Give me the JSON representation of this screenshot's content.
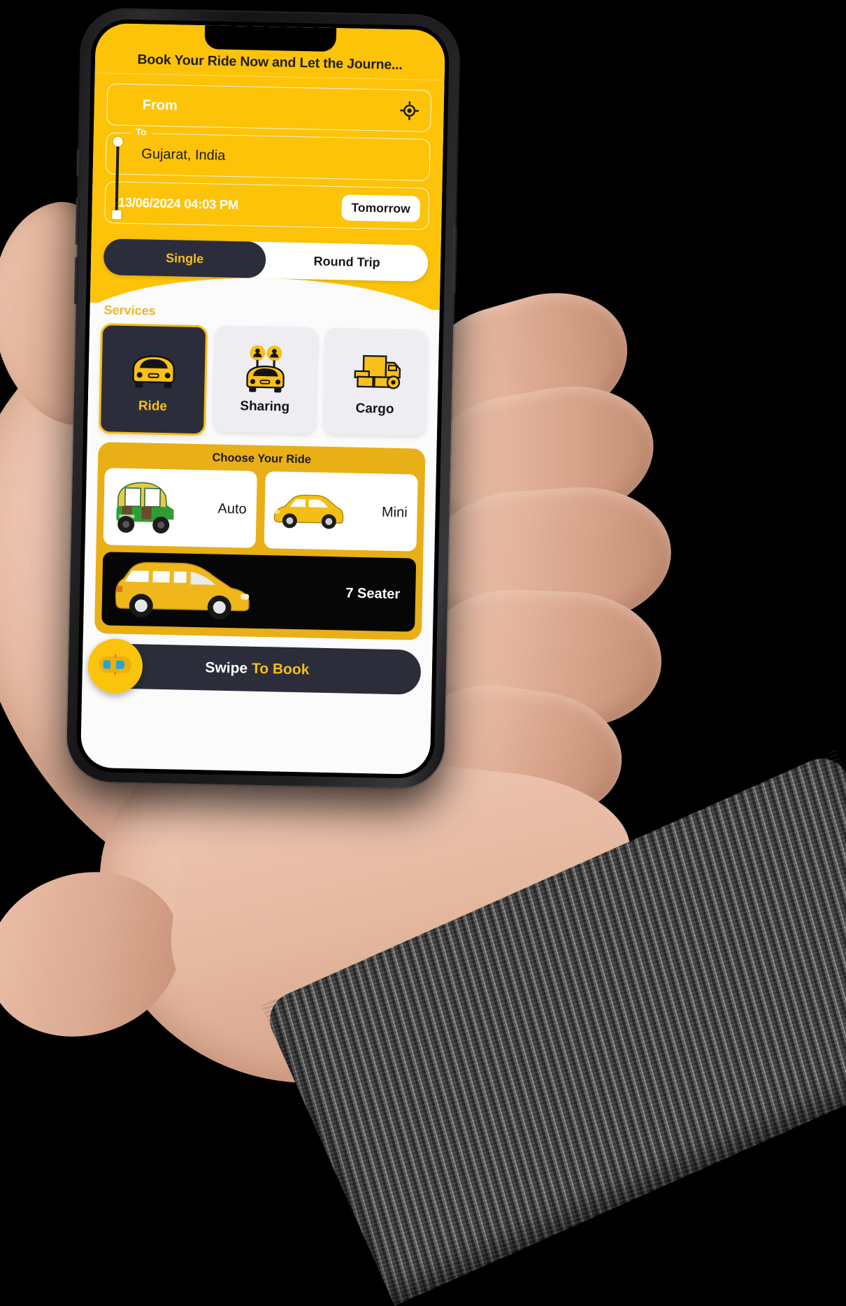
{
  "app": {
    "title": "Book Your Ride Now and Let the Journe..."
  },
  "trip_form": {
    "from_label": "From",
    "from_value": "",
    "to_caption": "To",
    "to_value": "Gujarat, India",
    "gps_icon": "crosshair-location-icon",
    "datetime_value": "13/06/2024 04:03 PM",
    "quick_date_chip": "Tomorrow",
    "trip_types": [
      {
        "label": "Single",
        "active": true
      },
      {
        "label": "Round Trip",
        "active": false
      }
    ]
  },
  "services": {
    "heading": "Services",
    "items": [
      {
        "label": "Ride",
        "icon": "car-front-icon",
        "active": true
      },
      {
        "label": "Sharing",
        "icon": "car-share-people-icon",
        "active": false
      },
      {
        "label": "Cargo",
        "icon": "cargo-truck-icon",
        "active": false
      }
    ]
  },
  "choose_ride": {
    "caption": "Choose Your Ride",
    "options": [
      {
        "label": "Auto",
        "icon": "auto-rickshaw-icon"
      },
      {
        "label": "Mini",
        "icon": "sedan-car-icon"
      },
      {
        "label": "7 Seater",
        "icon": "mpv-car-icon"
      }
    ]
  },
  "swipe_button": {
    "text_plain": "Swipe ",
    "text_accent": "To Book",
    "knob_icon": "car-top-view-icon"
  },
  "colors": {
    "brand_yellow": "#FCC309",
    "panel_gold": "#E8AF17",
    "dark_navy": "#2B2D3A",
    "accent_gold_text": "#F6C01E",
    "surface_light": "#EDEDF2",
    "screen_bg": "#FBFBFB"
  }
}
